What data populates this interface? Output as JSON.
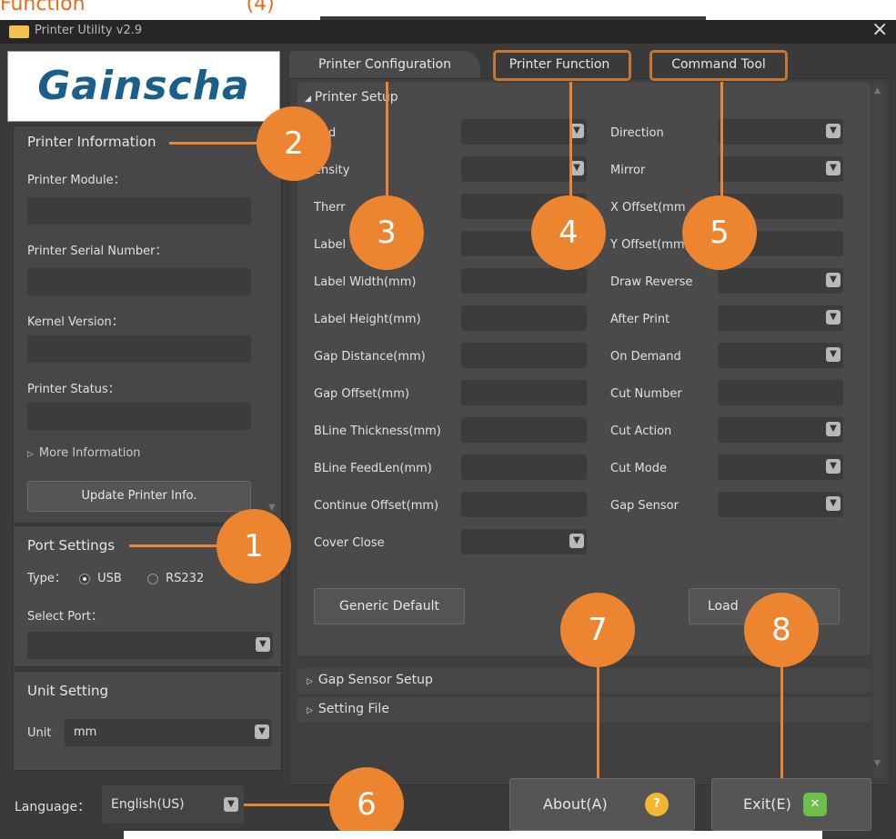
{
  "page_caption": "Function",
  "page_caption_suffix": "(4)",
  "window": {
    "title": "Printer Utility v2.9",
    "close_glyph": "×"
  },
  "logo": "Gainscha",
  "printer_info": {
    "header": "Printer Information",
    "module_label": "Printer Module：",
    "serial_label": "Printer Serial Number：",
    "kernel_label": "Kernel Version：",
    "status_label": "Printer Status：",
    "more_info": "More Information",
    "update_button": "Update Printer Info."
  },
  "port_settings": {
    "header": "Port Settings",
    "type_label": "Type：",
    "options": [
      "USB",
      "RS232"
    ],
    "selected": "USB",
    "select_port_label": "Select Port："
  },
  "unit_setting": {
    "header": "Unit Setting",
    "unit_label": "Unit",
    "unit_value": "mm"
  },
  "language": {
    "label": "Language：",
    "value": "English(US)"
  },
  "tabs": [
    "Printer Configuration",
    "Printer Function",
    "Command Tool"
  ],
  "printer_setup": {
    "header": "Printer Setup",
    "left_fields": [
      {
        "label": "Speed",
        "visible": "eed",
        "kind": "combo"
      },
      {
        "label": "Density",
        "visible": "ensity",
        "kind": "combo"
      },
      {
        "label": "Thermal",
        "visible": "Therr",
        "kind": "combo"
      },
      {
        "label": "Label",
        "visible": "Label",
        "kind": "combo"
      },
      {
        "label": "Label Width(mm)",
        "kind": "text"
      },
      {
        "label": "Label Height(mm)",
        "kind": "text"
      },
      {
        "label": "Gap Distance(mm)",
        "kind": "text"
      },
      {
        "label": "Gap Offset(mm)",
        "kind": "text"
      },
      {
        "label": "BLine Thickness(mm)",
        "kind": "text"
      },
      {
        "label": "BLine FeedLen(mm)",
        "kind": "text"
      },
      {
        "label": "Continue Offset(mm)",
        "kind": "text"
      },
      {
        "label": "Cover Close",
        "kind": "combo"
      }
    ],
    "right_fields": [
      {
        "label": "Direction",
        "kind": "combo"
      },
      {
        "label": "Mirror",
        "kind": "combo"
      },
      {
        "label": "X Offset(mm)",
        "visible": "X Offset(mm",
        "kind": "text"
      },
      {
        "label": "Y Offset(mm)",
        "visible": "Y Offset(mm)",
        "kind": "text"
      },
      {
        "label": "Draw Reverse",
        "kind": "combo"
      },
      {
        "label": "After Print",
        "kind": "combo"
      },
      {
        "label": "On Demand",
        "kind": "combo"
      },
      {
        "label": "Cut Number",
        "kind": "text"
      },
      {
        "label": "Cut Action",
        "kind": "combo"
      },
      {
        "label": "Cut Mode",
        "kind": "combo"
      },
      {
        "label": "Gap Sensor",
        "kind": "combo"
      }
    ],
    "generic_default_button": "Generic Default",
    "load_button": "Load"
  },
  "sections": [
    "Gap Sensor Setup",
    "Setting File"
  ],
  "about_button": "About(A)",
  "exit_button": "Exit(E)",
  "callouts": [
    "1",
    "2",
    "3",
    "4",
    "5",
    "6",
    "7",
    "8"
  ],
  "colors": {
    "accent": "#ec8430",
    "highlight": "#c8762d",
    "window_bg": "#3a3a3a"
  }
}
